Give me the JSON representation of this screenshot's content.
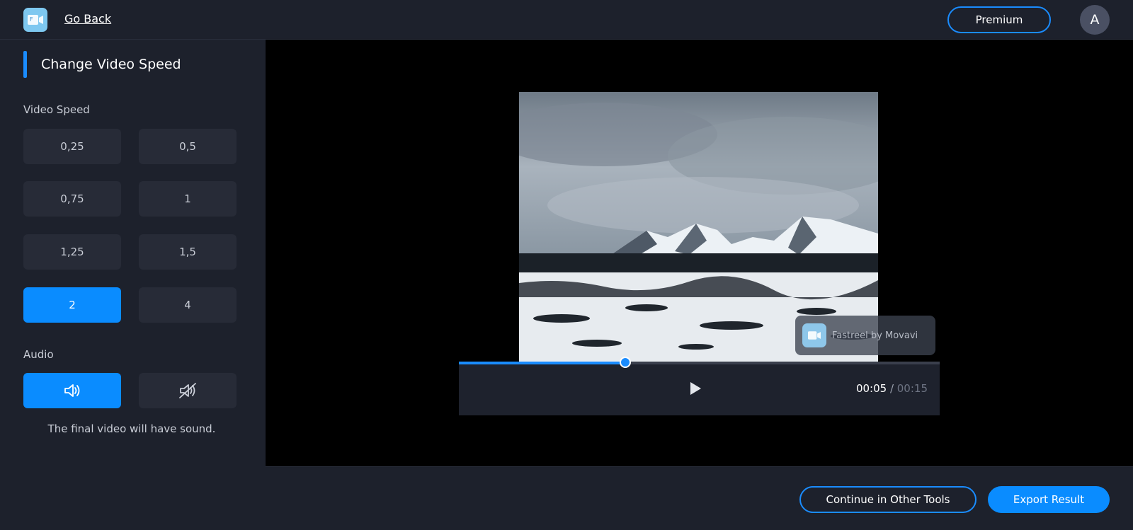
{
  "header": {
    "logo_icon": "fastreel-logo-icon",
    "go_back_label": "Go Back",
    "premium_label": "Premium",
    "avatar_initial": "A"
  },
  "sidebar": {
    "title": "Change Video Speed",
    "speed_label": "Video Speed",
    "speed_options": [
      "0,25",
      "0,5",
      "0,75",
      "1",
      "1,25",
      "1,5",
      "2",
      "4"
    ],
    "selected_speed": "2",
    "audio_label": "Audio",
    "audio_on_icon": "speaker-icon",
    "audio_off_icon": "speaker-muted-icon",
    "audio_selected": "on",
    "audio_note": "The final video will have sound."
  },
  "player": {
    "watermark_text": "Fastreel by Movavi",
    "current_time": "00:05",
    "separator": " / ",
    "duration": "00:15",
    "progress": 0.346,
    "play_icon": "play-icon"
  },
  "footer": {
    "continue_label": "Continue in Other Tools",
    "export_label": "Export Result"
  },
  "colors": {
    "accent": "#0a8cff",
    "background": "#1d212c",
    "button": "#272b37",
    "stage": "#000000"
  }
}
